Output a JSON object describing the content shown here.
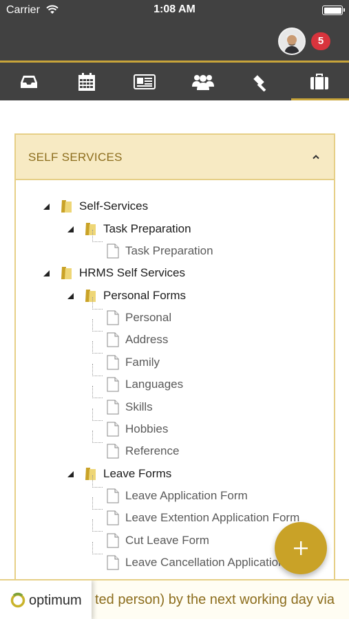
{
  "status_bar": {
    "carrier": "Carrier",
    "time": "1:08 AM"
  },
  "header": {
    "notification_count": "5"
  },
  "nav": {
    "tabs": [
      {
        "icon": "inbox-icon"
      },
      {
        "icon": "calendar-icon"
      },
      {
        "icon": "news-icon"
      },
      {
        "icon": "people-icon"
      },
      {
        "icon": "gavel-icon"
      },
      {
        "icon": "briefcase-icon",
        "active": true
      }
    ],
    "accent": "#c8a53a"
  },
  "panel": {
    "title": "SELF SERVICES",
    "tree": [
      {
        "label": "Self-Services",
        "type": "folder"
      },
      {
        "label": "Task Preparation",
        "type": "folder"
      },
      {
        "label": "Task Preparation",
        "type": "file"
      },
      {
        "label": "HRMS Self Services",
        "type": "folder"
      },
      {
        "label": "Personal Forms",
        "type": "folder"
      },
      {
        "label": "Personal",
        "type": "file"
      },
      {
        "label": "Address",
        "type": "file"
      },
      {
        "label": "Family",
        "type": "file"
      },
      {
        "label": "Languages",
        "type": "file"
      },
      {
        "label": "Skills",
        "type": "file"
      },
      {
        "label": "Hobbies",
        "type": "file"
      },
      {
        "label": "Reference",
        "type": "file"
      },
      {
        "label": "Leave Forms",
        "type": "folder"
      },
      {
        "label": "Leave Application Form",
        "type": "file"
      },
      {
        "label": "Leave Extention Application Form",
        "type": "file"
      },
      {
        "label": "Cut Leave Form",
        "type": "file"
      },
      {
        "label": "Leave Cancellation Application Form",
        "type": "file"
      }
    ]
  },
  "fab": {
    "label": "+"
  },
  "footer": {
    "marquee": "ted person) by the next working day via",
    "logo": "optimum"
  },
  "colors": {
    "brand_gold": "#c9a227",
    "dark_bar": "#414141",
    "badge_red": "#d8343d",
    "panel_header_bg": "#f7eac3"
  }
}
